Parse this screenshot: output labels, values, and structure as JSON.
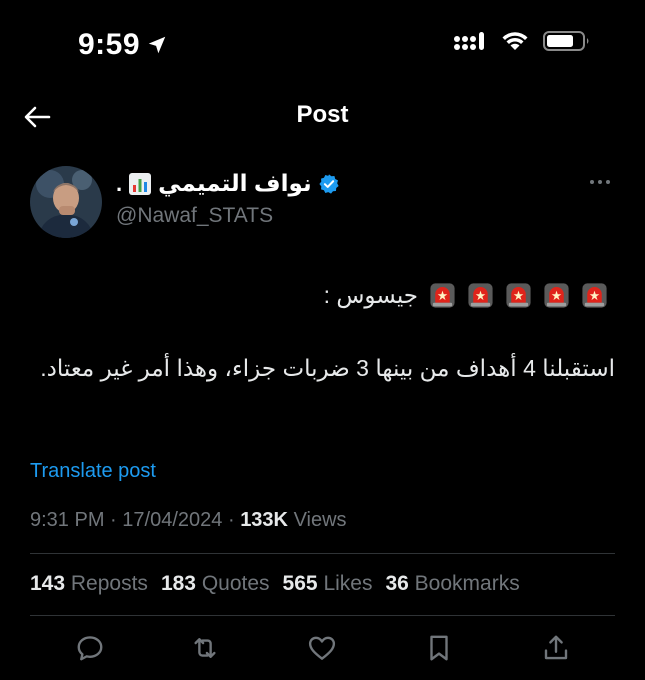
{
  "status_bar": {
    "time": "9:59",
    "icons": [
      "location-arrow-icon",
      "cellular-signal-icon",
      "wifi-icon",
      "battery-icon"
    ]
  },
  "nav": {
    "back_icon": "arrow-left-icon",
    "title": "Post"
  },
  "author": {
    "name": "نواف التميمي",
    "name_suffix": ".",
    "emoji": "bar-chart-emoji",
    "verified_icon": "verified-badge-icon",
    "handle": "@Nawaf_STATS",
    "more_icon": "more-horizontal-icon"
  },
  "post": {
    "line1": "جيسوس :",
    "siren_count": 5,
    "siren_icon": "police-siren-emoji",
    "body": "استقبلنا 4 أهداف من بينها 3 ضربات جزاء، وهذا أمر غير معتاد."
  },
  "translate_label": "Translate post",
  "meta": {
    "time": "9:31 PM",
    "date": "17/04/2024",
    "separator": "·",
    "views_count": "133K",
    "views_label": "Views"
  },
  "stats": {
    "reposts_count": "143",
    "reposts_label": "Reposts",
    "quotes_count": "183",
    "quotes_label": "Quotes",
    "likes_count": "565",
    "likes_label": "Likes",
    "bookmarks_count": "36",
    "bookmarks_label": "Bookmarks"
  },
  "actions": [
    "reply-icon",
    "repost-icon",
    "like-icon",
    "bookmark-icon",
    "share-icon"
  ],
  "colors": {
    "background": "#000000",
    "text_primary": "#e7e9ea",
    "text_secondary": "#71767b",
    "link": "#1d9bf0",
    "divider": "#2f3336"
  }
}
